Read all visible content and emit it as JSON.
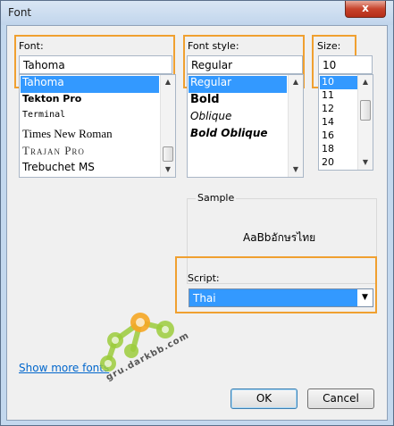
{
  "window": {
    "title": "Font",
    "close_glyph": "x"
  },
  "font": {
    "label": "Font:",
    "value": "Tahoma",
    "items": [
      {
        "label": "Tahoma",
        "selected": true
      },
      {
        "label": "Tekton Pro",
        "selected": false
      },
      {
        "label": "Terminal",
        "selected": false
      },
      {
        "label": "Times New Roman",
        "selected": false
      },
      {
        "label": "Trajan Pro",
        "selected": false
      },
      {
        "label": "Trebuchet MS",
        "selected": false
      }
    ]
  },
  "style": {
    "label": "Font style:",
    "value": "Regular",
    "items": [
      {
        "label": "Regular",
        "selected": true
      },
      {
        "label": "Bold",
        "selected": false
      },
      {
        "label": "Oblique",
        "selected": false
      },
      {
        "label": "Bold Oblique",
        "selected": false
      }
    ]
  },
  "size": {
    "label": "Size:",
    "value": "10",
    "items": [
      {
        "label": "10",
        "selected": true
      },
      {
        "label": "11",
        "selected": false
      },
      {
        "label": "12",
        "selected": false
      },
      {
        "label": "14",
        "selected": false
      },
      {
        "label": "16",
        "selected": false
      },
      {
        "label": "18",
        "selected": false
      },
      {
        "label": "20",
        "selected": false
      }
    ]
  },
  "sample": {
    "label": "Sample",
    "text": "AaBbอักษรไทย"
  },
  "script": {
    "label": "Script:",
    "value": "Thai"
  },
  "link": {
    "label": "Show more fonts"
  },
  "buttons": {
    "ok": "OK",
    "cancel": "Cancel"
  },
  "watermark": {
    "text": "gru.darkbb.com"
  },
  "colors": {
    "highlight": "#3399ff",
    "annotation_box": "#f0a030",
    "link": "#0066cc"
  }
}
